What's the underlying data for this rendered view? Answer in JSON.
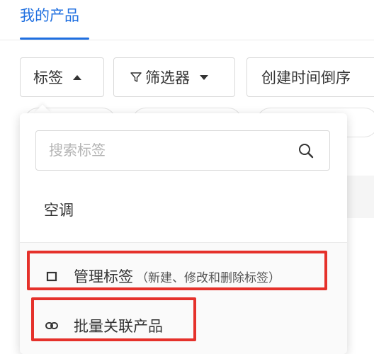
{
  "header": {
    "active_tab": "我的产品"
  },
  "toolbar": {
    "tag_button": "标签",
    "filter_button": "筛选器",
    "sort_button": "创建时间倒序"
  },
  "tag_dropdown": {
    "search": {
      "placeholder": "搜索标签",
      "value": ""
    },
    "options": [
      "空调"
    ],
    "actions": {
      "manage": {
        "label": "管理标签",
        "hint": "（新建、修改和删除标签）"
      },
      "bind": {
        "label": "批量关联产品"
      }
    }
  },
  "colors": {
    "accent": "#1f6fe0",
    "highlight": "#e5312b"
  }
}
